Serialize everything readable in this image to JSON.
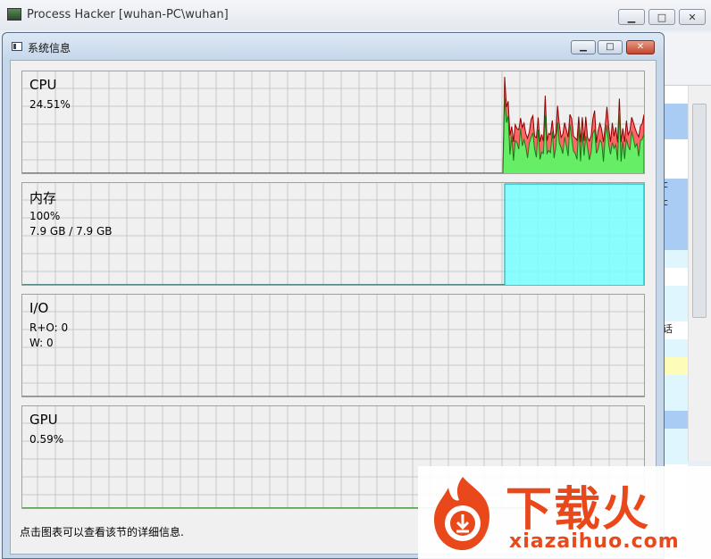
{
  "background_window": {
    "title": "Process Hacker [wuhan-PC\\wuhan]",
    "minimize_icon": "minimize-icon",
    "maximize_icon": "maximize-icon",
    "close_icon": "close-icon",
    "list_fragments": [
      "c",
      "c",
      "话"
    ]
  },
  "dialog": {
    "title": "系统信息",
    "minimize_icon": "minimize-icon",
    "maximize_icon": "maximize-icon",
    "close_icon": "close-icon",
    "footer": "点击图表可以查看该节的详细信息."
  },
  "panels": {
    "cpu": {
      "label": "CPU",
      "values": [
        "24.51%"
      ]
    },
    "memory": {
      "label": "内存",
      "values": [
        "100%",
        "7.9 GB / 7.9 GB"
      ]
    },
    "io": {
      "label": "I/O",
      "values": [
        "R+O: 0",
        "W: 0"
      ]
    },
    "gpu": {
      "label": "GPU",
      "values": [
        "0.59%"
      ]
    }
  },
  "colors": {
    "cpu_kernel": "#ff6666",
    "cpu_user": "#66ee66",
    "memory_fill": "#77ffff",
    "grid": "#c8c8c8",
    "baseline": "#2a8a2a",
    "watermark": "#e8481a"
  },
  "watermark": {
    "brand": "下载火",
    "url": "xiazaihuo.com"
  }
}
